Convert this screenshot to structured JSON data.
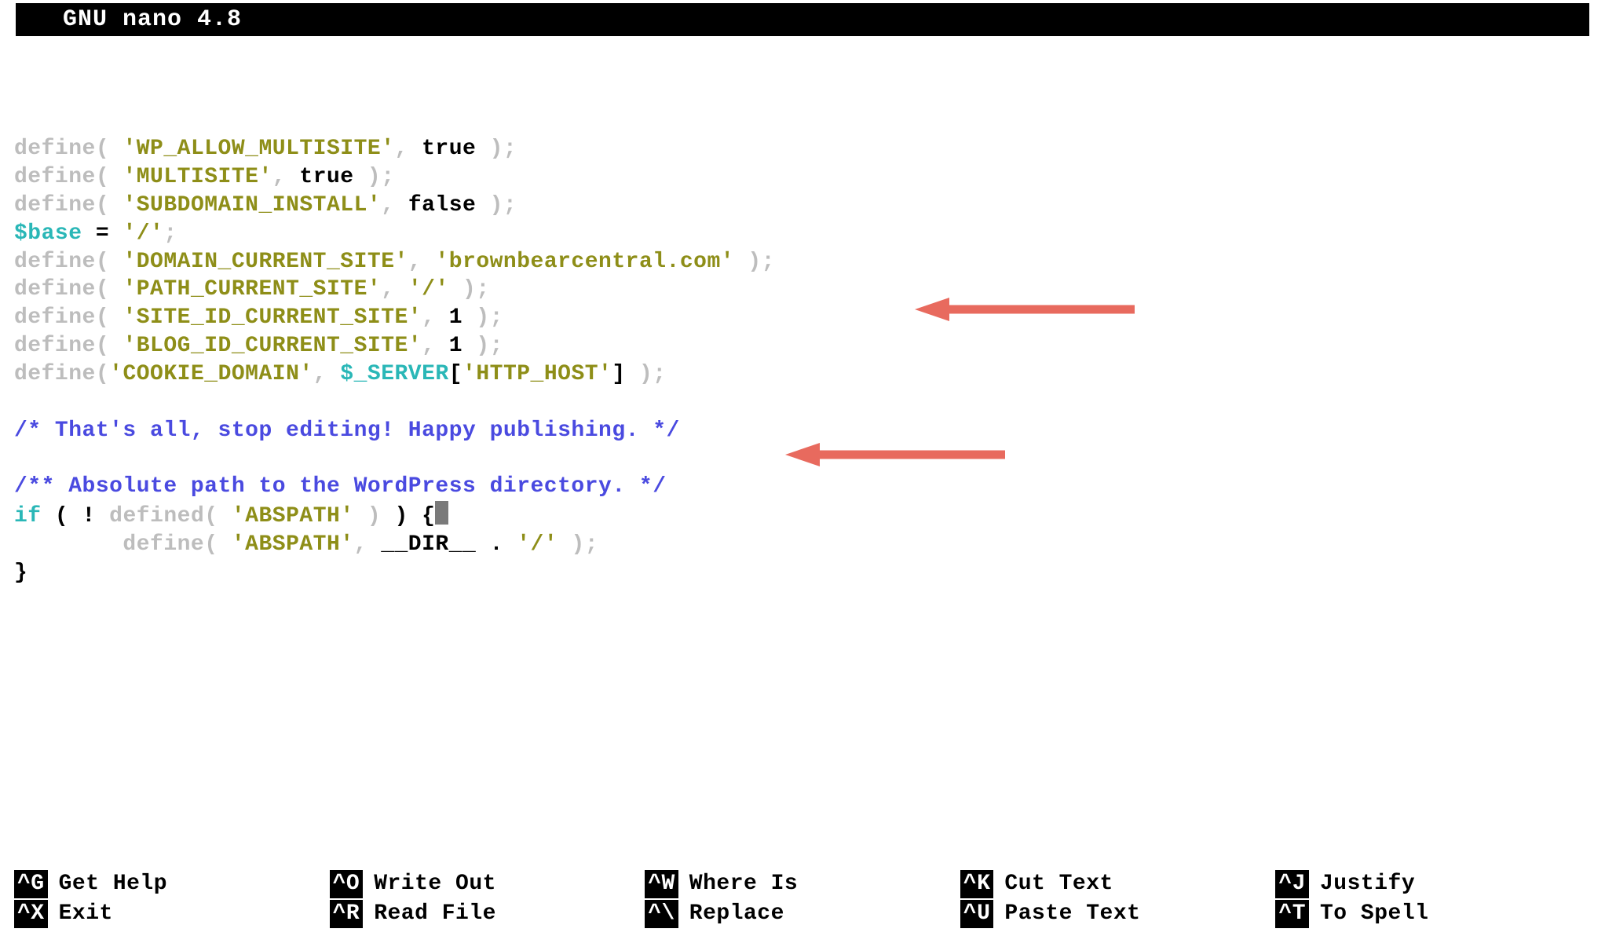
{
  "titlebar": "GNU nano 4.8",
  "code": {
    "l1": {
      "define": "define",
      "paren_open": "( ",
      "key": "'WP_ALLOW_MULTISITE'",
      "comma": ", ",
      "val": "true",
      "end": " );"
    },
    "l2": {
      "define": "define",
      "paren_open": "( ",
      "key": "'MULTISITE'",
      "comma": ", ",
      "val": "true",
      "end": " );"
    },
    "l3": {
      "define": "define",
      "paren_open": "( ",
      "key": "'SUBDOMAIN_INSTALL'",
      "comma": ", ",
      "val": "false",
      "end": " );"
    },
    "l4": {
      "var": "$base",
      "assign": " = ",
      "val": "'/'",
      "end": ";"
    },
    "l5": {
      "define": "define",
      "paren_open": "( ",
      "key": "'DOMAIN_CURRENT_SITE'",
      "comma": ", ",
      "val": "'brownbearcentral.com'",
      "end": " );"
    },
    "l6": {
      "define": "define",
      "paren_open": "( ",
      "key": "'PATH_CURRENT_SITE'",
      "comma": ", ",
      "val": "'/'",
      "end": " );"
    },
    "l7": {
      "define": "define",
      "paren_open": "( ",
      "key": "'SITE_ID_CURRENT_SITE'",
      "comma": ", ",
      "val": "1",
      "end": " );"
    },
    "l8": {
      "define": "define",
      "paren_open": "( ",
      "key": "'BLOG_ID_CURRENT_SITE'",
      "comma": ", ",
      "val": "1",
      "end": " );"
    },
    "l9": {
      "define": "define",
      "paren_open": "(",
      "key": "'COOKIE_DOMAIN'",
      "comma": ", ",
      "server": "$_SERVER",
      "bracket_open": "[",
      "hostkey": "'HTTP_HOST'",
      "bracket_close": "]",
      "end": " );"
    },
    "comment1": "/* That's all, stop editing! Happy publishing. */",
    "comment2": "/** Absolute path to the WordPress directory. */",
    "ifline": {
      "if": "if",
      "open": " ( ",
      "bang": "!",
      "sp": " ",
      "defined": "defined",
      "paren_open": "( ",
      "arg": "'ABSPATH'",
      "paren_close": " ) ",
      "close": ") ",
      "brace": "{"
    },
    "defline": {
      "indent": "        ",
      "define": "define",
      "paren_open": "( ",
      "arg1": "'ABSPATH'",
      "comma": ", ",
      "dir": "__DIR__",
      "dot": " . ",
      "slash": "'/'",
      "end": " );"
    },
    "closebrace": "}"
  },
  "shortcuts": [
    {
      "key": "^G",
      "label": "Get Help"
    },
    {
      "key": "^O",
      "label": "Write Out"
    },
    {
      "key": "^W",
      "label": "Where Is"
    },
    {
      "key": "^K",
      "label": "Cut Text"
    },
    {
      "key": "^J",
      "label": "Justify"
    },
    {
      "key": "^X",
      "label": "Exit"
    },
    {
      "key": "^R",
      "label": "Read File"
    },
    {
      "key": "^\\",
      "label": "Replace"
    },
    {
      "key": "^U",
      "label": "Paste Text"
    },
    {
      "key": "^T",
      "label": "To Spell"
    }
  ]
}
